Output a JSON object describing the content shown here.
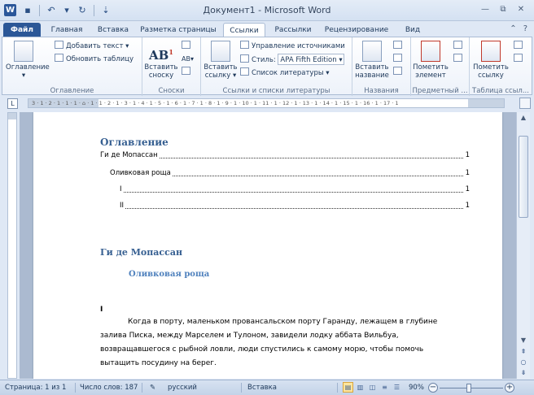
{
  "window": {
    "title": "Документ1 - Microsoft Word",
    "app_icon": "W",
    "qat": {
      "save_icon": "save-icon",
      "undo_icon": "undo-icon",
      "redo_icon": "redo-icon"
    },
    "controls": {
      "minimize": "▭",
      "restore": "⧉",
      "close": "✕"
    }
  },
  "tabs": [
    {
      "label": "Файл"
    },
    {
      "label": "Главная"
    },
    {
      "label": "Вставка"
    },
    {
      "label": "Разметка страницы"
    },
    {
      "label": "Ссылки"
    },
    {
      "label": "Рассылки"
    },
    {
      "label": "Рецензирование"
    },
    {
      "label": "Вид"
    }
  ],
  "ribbon": {
    "toc_group": {
      "label": "Оглавление",
      "toc_button": "Оглавление",
      "add_text": "Добавить текст ▾",
      "update_table": "Обновить таблицу"
    },
    "footnotes_group": {
      "label": "Сноски",
      "insert_footnote_l1": "Вставить",
      "insert_footnote_l2": "сноску"
    },
    "citations_group": {
      "label": "Ссылки и списки литературы",
      "insert_citation_l1": "Вставить",
      "insert_citation_l2": "ссылку ▾",
      "manage_sources": "Управление источниками",
      "style_label": "Стиль:",
      "style_value": "APA Fifth Edition",
      "bibliography": "Список литературы ▾"
    },
    "captions_group": {
      "label": "Названия",
      "insert_caption_l1": "Вставить",
      "insert_caption_l2": "название"
    },
    "index_group": {
      "label": "Предметный ...",
      "mark_entry_l1": "Пометить",
      "mark_entry_l2": "элемент"
    },
    "toa_group": {
      "label": "Таблица ссыл...",
      "mark_citation_l1": "Пометить",
      "mark_citation_l2": "ссылку"
    }
  },
  "ruler": {
    "tab_selector": "L",
    "marks": "3 · 1 · 2 · 1 · 1 · 1 · ⌂ · 1 · 1 · 2 · 1 · 3 · 1 · 4 · 1 · 5 · 1 · 6 · 1 · 7 · 1 · 8 · 1 · 9 · 1 · 10 · 1 · 11 · 1 · 12 · 1 · 13 · 1 · 14 · 1 · 15 · 1 · 16 · 1 · 17 · 1"
  },
  "document": {
    "toc_title": "Оглавление",
    "toc_entries": [
      {
        "text": "Ги де Мопассан",
        "page": "1"
      },
      {
        "text": "Оливковая роща",
        "page": "1"
      },
      {
        "text": "I",
        "page": "1"
      },
      {
        "text": "II",
        "page": "1"
      }
    ],
    "heading1": "Ги де Мопассан",
    "heading2": "Оливковая роща",
    "section_number": "I",
    "paragraph": "Когда в порту, маленьком провансальском порту Гаранду, лежащем в глубине залива Писка, между Марселем и Тулоном, завидели лодку аббата Вильбуа, возвращавшегося с рыбной ловли, люди спустились к самому морю, чтобы помочь вытащить посудину на берег."
  },
  "statusbar": {
    "page": "Страница: 1 из 1",
    "words": "Число слов: 187",
    "language": "русский",
    "mode": "Вставка",
    "zoom": "90%",
    "zoom_level": 0.9
  }
}
